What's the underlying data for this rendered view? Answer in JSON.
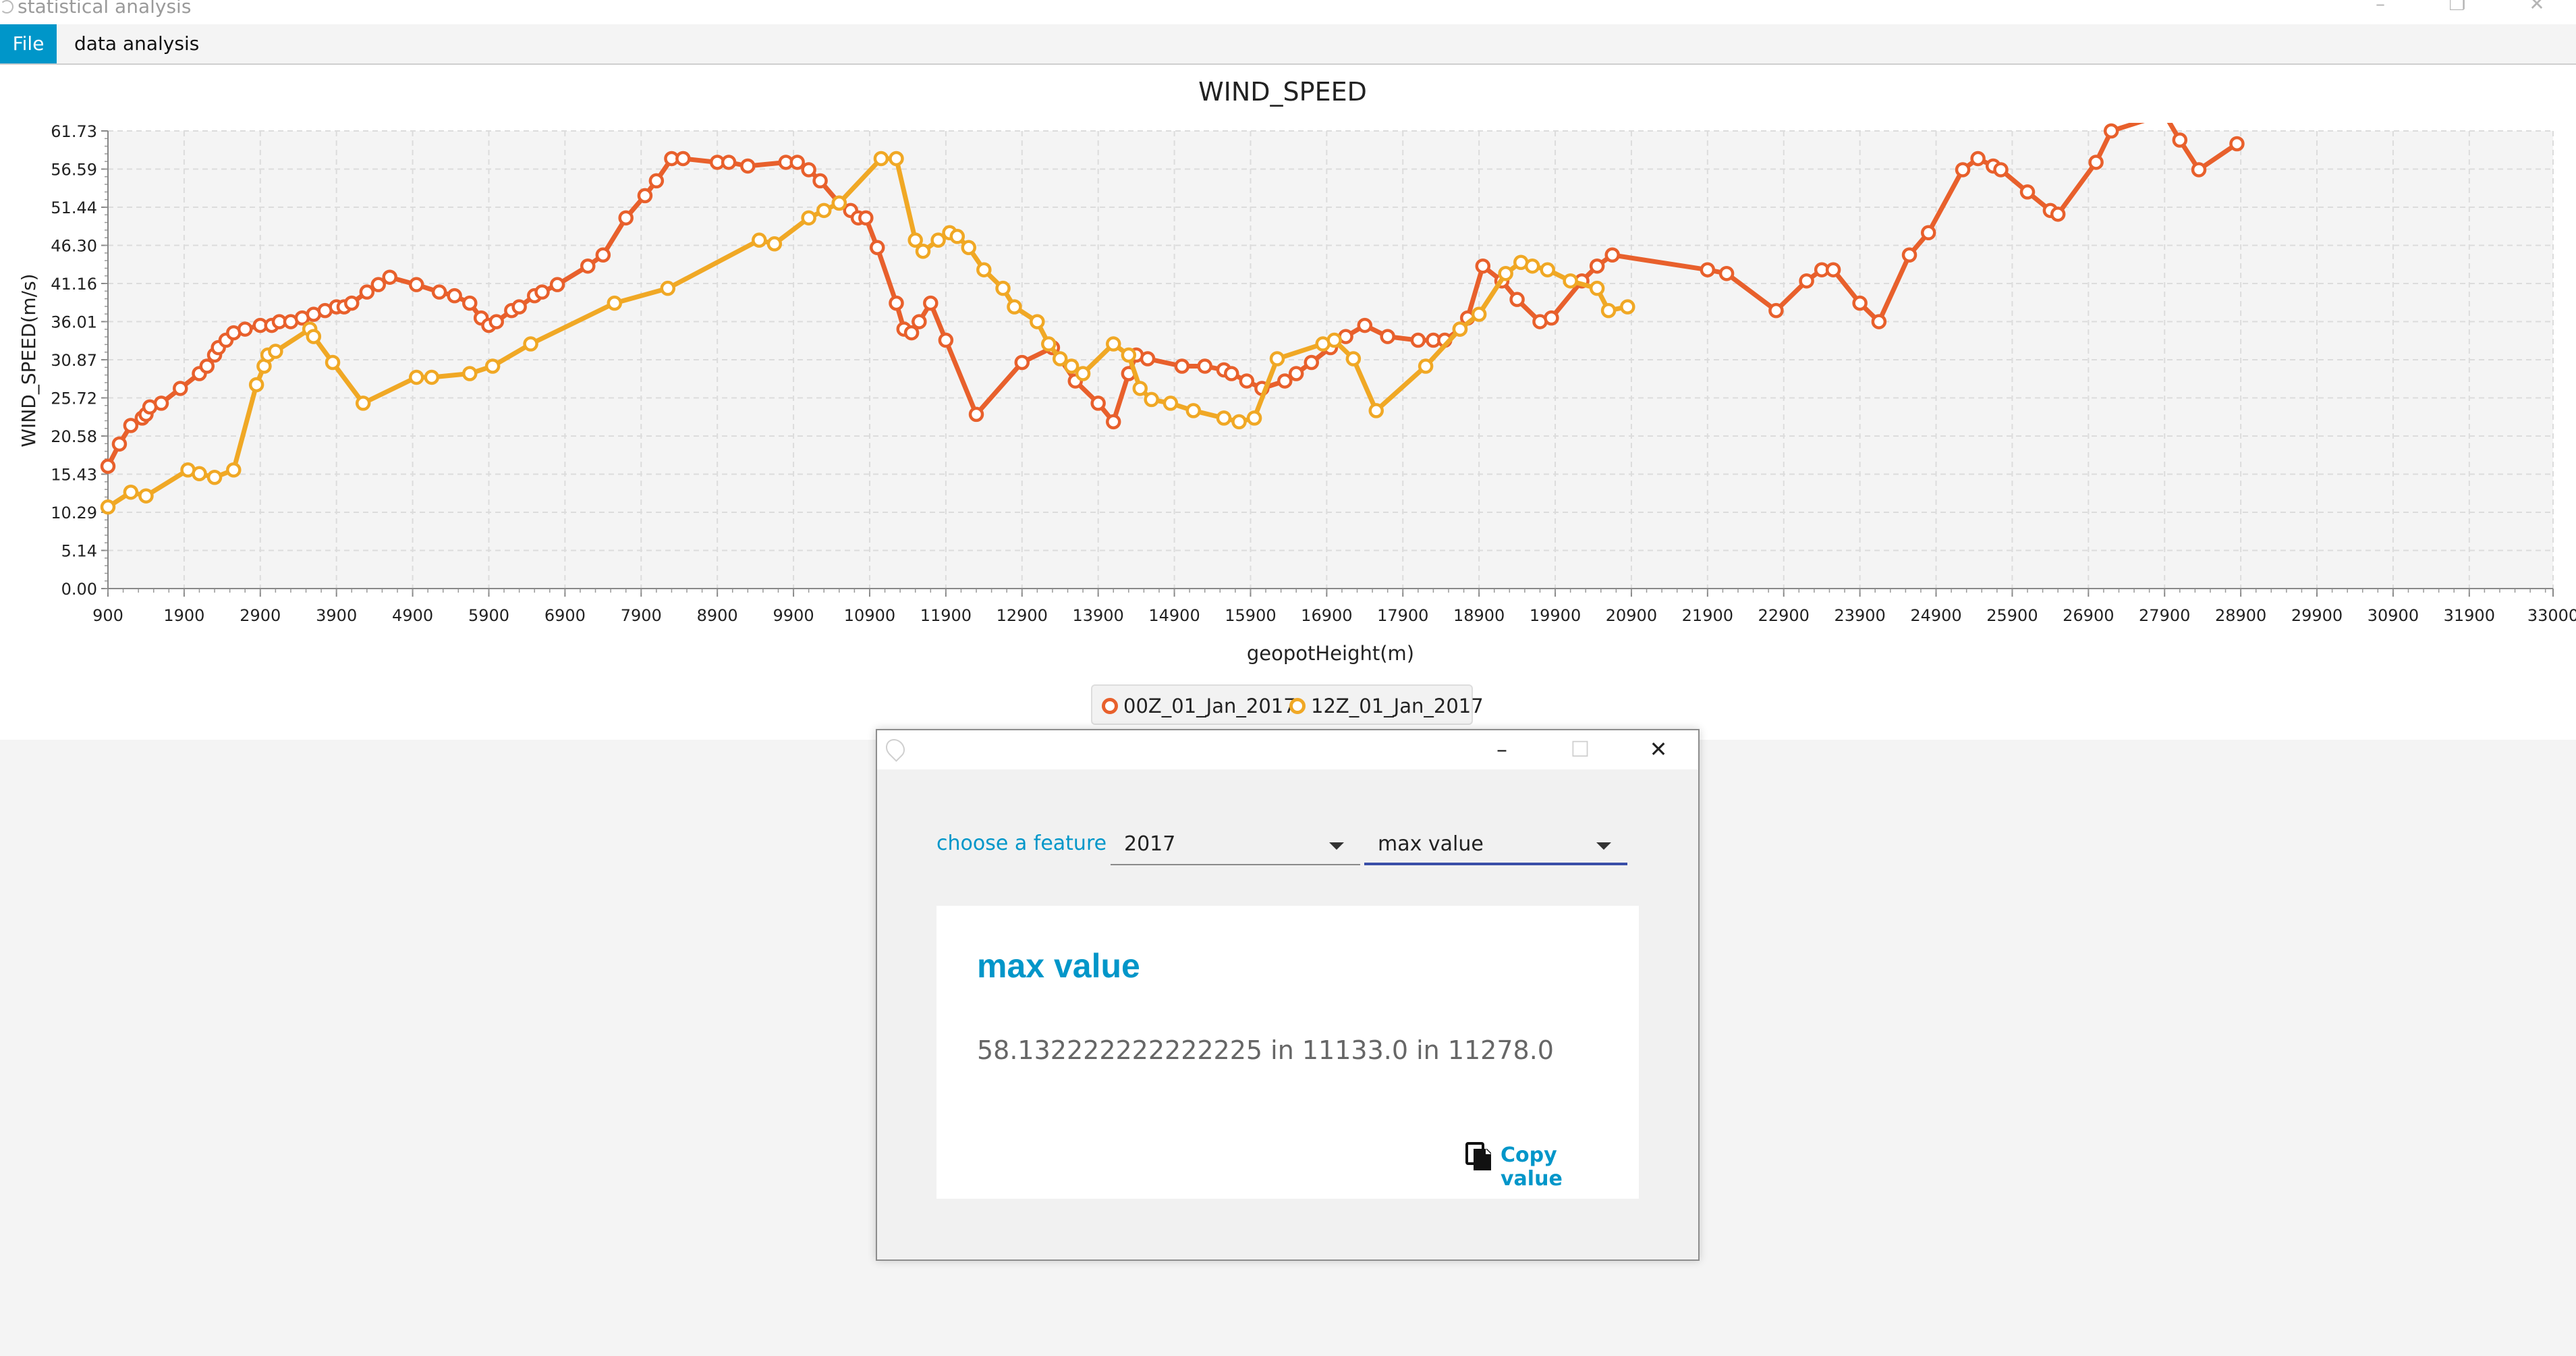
{
  "window": {
    "title": "statistical analysis",
    "controls": [
      "–",
      "❐",
      "✕"
    ]
  },
  "menu": {
    "file": "File",
    "data_analysis": "data analysis"
  },
  "chart_data": {
    "type": "line",
    "title": "WIND_SPEED",
    "xlabel": "geopotHeight(m)",
    "ylabel": "WIND_SPEED(m/s)",
    "xlim": [
      900,
      33000
    ],
    "ylim": [
      0,
      61.73
    ],
    "x_ticks": [
      "900",
      "1900",
      "2900",
      "3900",
      "4900",
      "5900",
      "6900",
      "7900",
      "8900",
      "9900",
      "10900",
      "11900",
      "12900",
      "13900",
      "14900",
      "15900",
      "16900",
      "17900",
      "18900",
      "19900",
      "20900",
      "21900",
      "22900",
      "23900",
      "24900",
      "25900",
      "26900",
      "27900",
      "28900",
      "29900",
      "30900",
      "31900",
      "33000"
    ],
    "y_ticks": [
      "0.00",
      "5.14",
      "10.29",
      "15.43",
      "20.58",
      "25.72",
      "30.87",
      "36.01",
      "41.16",
      "46.30",
      "51.44",
      "56.59",
      "61.73"
    ],
    "grid": true,
    "legend_position": "bottom",
    "series": [
      {
        "name": "00Z_01_Jan_2017",
        "color": "#e8602c",
        "points": [
          [
            900,
            16.5
          ],
          [
            1050,
            19.5
          ],
          [
            1200,
            22
          ],
          [
            1350,
            23
          ],
          [
            1400,
            23.5
          ],
          [
            1450,
            24.5
          ],
          [
            1600,
            25
          ],
          [
            1850,
            27
          ],
          [
            2100,
            29
          ],
          [
            2200,
            30
          ],
          [
            2300,
            31.5
          ],
          [
            2350,
            32.5
          ],
          [
            2450,
            33.5
          ],
          [
            2550,
            34.5
          ],
          [
            2700,
            35
          ],
          [
            2900,
            35.5
          ],
          [
            3050,
            35.5
          ],
          [
            3150,
            36
          ],
          [
            3300,
            36
          ],
          [
            3450,
            36.5
          ],
          [
            3600,
            37
          ],
          [
            3750,
            37.5
          ],
          [
            3900,
            38
          ],
          [
            4000,
            38
          ],
          [
            4100,
            38.5
          ],
          [
            4300,
            40
          ],
          [
            4450,
            41
          ],
          [
            4600,
            42
          ],
          [
            4950,
            41
          ],
          [
            5250,
            40
          ],
          [
            5450,
            39.5
          ],
          [
            5650,
            38.5
          ],
          [
            5800,
            36.5
          ],
          [
            5900,
            35.5
          ],
          [
            6000,
            36
          ],
          [
            6200,
            37.5
          ],
          [
            6300,
            38
          ],
          [
            6500,
            39.5
          ],
          [
            6600,
            40
          ],
          [
            6800,
            41
          ],
          [
            7200,
            43.5
          ],
          [
            7400,
            45
          ],
          [
            7700,
            50
          ],
          [
            7950,
            53
          ],
          [
            8100,
            55
          ],
          [
            8300,
            58
          ],
          [
            8450,
            58
          ],
          [
            8900,
            57.5
          ],
          [
            9050,
            57.5
          ],
          [
            9300,
            57
          ],
          [
            9800,
            57.5
          ],
          [
            9950,
            57.5
          ],
          [
            10100,
            56.5
          ],
          [
            10250,
            55
          ],
          [
            10500,
            52
          ],
          [
            10650,
            51
          ],
          [
            10750,
            50
          ],
          [
            10850,
            50
          ],
          [
            11000,
            46
          ],
          [
            11250,
            38.5
          ],
          [
            11350,
            35
          ],
          [
            11450,
            34.5
          ],
          [
            11550,
            36
          ],
          [
            11700,
            38.5
          ],
          [
            11900,
            33.5
          ],
          [
            12300,
            23.5
          ],
          [
            12900,
            30.5
          ],
          [
            13300,
            32.5
          ],
          [
            13600,
            28
          ],
          [
            13900,
            25
          ],
          [
            14100,
            22.5
          ],
          [
            14300,
            29
          ],
          [
            14400,
            31.5
          ],
          [
            14550,
            31
          ],
          [
            15000,
            30
          ],
          [
            15300,
            30
          ],
          [
            15550,
            29.5
          ],
          [
            15650,
            29
          ],
          [
            15850,
            28
          ],
          [
            16050,
            27
          ],
          [
            16350,
            28
          ],
          [
            16500,
            29
          ],
          [
            16700,
            30.5
          ],
          [
            16950,
            32.5
          ],
          [
            17150,
            34
          ],
          [
            17400,
            35.5
          ],
          [
            17700,
            34
          ],
          [
            18100,
            33.5
          ],
          [
            18300,
            33.5
          ],
          [
            18450,
            33.5
          ],
          [
            18650,
            35
          ],
          [
            18750,
            36.5
          ],
          [
            18950,
            43.5
          ],
          [
            19200,
            41.5
          ],
          [
            19400,
            39
          ],
          [
            19700,
            36
          ],
          [
            19850,
            36.5
          ],
          [
            20250,
            41.5
          ],
          [
            20450,
            43.5
          ],
          [
            20650,
            45
          ],
          [
            21900,
            43
          ],
          [
            22150,
            42.5
          ],
          [
            22800,
            37.5
          ],
          [
            23200,
            41.5
          ],
          [
            23400,
            43
          ],
          [
            23550,
            43
          ],
          [
            23900,
            38.5
          ],
          [
            24150,
            36
          ],
          [
            24550,
            45
          ],
          [
            24800,
            48
          ],
          [
            25250,
            56.5
          ],
          [
            25450,
            58
          ],
          [
            25650,
            57
          ],
          [
            25750,
            56.5
          ],
          [
            26100,
            53.5
          ],
          [
            26400,
            51
          ],
          [
            26500,
            50.5
          ],
          [
            27000,
            57.5
          ],
          [
            27200,
            61.73
          ],
          [
            27900,
            64
          ],
          [
            28100,
            60.5
          ],
          [
            28350,
            56.5
          ],
          [
            28850,
            60
          ]
        ]
      },
      {
        "name": "12Z_01_Jan_2017",
        "color": "#f0a825",
        "points": [
          [
            900,
            11
          ],
          [
            1200,
            13
          ],
          [
            1400,
            12.5
          ],
          [
            1950,
            16
          ],
          [
            2100,
            15.5
          ],
          [
            2300,
            15
          ],
          [
            2550,
            16
          ],
          [
            2850,
            27.5
          ],
          [
            2950,
            30
          ],
          [
            3000,
            31.5
          ],
          [
            3100,
            32
          ],
          [
            3550,
            35
          ],
          [
            3600,
            34
          ],
          [
            3850,
            30.5
          ],
          [
            4250,
            25
          ],
          [
            4950,
            28.5
          ],
          [
            5150,
            28.5
          ],
          [
            5650,
            29
          ],
          [
            5950,
            30
          ],
          [
            6450,
            33
          ],
          [
            7550,
            38.5
          ],
          [
            8250,
            40.5
          ],
          [
            9450,
            47
          ],
          [
            9650,
            46.5
          ],
          [
            10100,
            50
          ],
          [
            10300,
            51
          ],
          [
            10500,
            52
          ],
          [
            11050,
            58
          ],
          [
            11250,
            58
          ],
          [
            11500,
            47
          ],
          [
            11600,
            45.5
          ],
          [
            11800,
            47
          ],
          [
            11950,
            48
          ],
          [
            12050,
            47.5
          ],
          [
            12200,
            46
          ],
          [
            12400,
            43
          ],
          [
            12650,
            40.5
          ],
          [
            12800,
            38
          ],
          [
            13100,
            36
          ],
          [
            13250,
            33
          ],
          [
            13400,
            31
          ],
          [
            13550,
            30
          ],
          [
            13700,
            29
          ],
          [
            14100,
            33
          ],
          [
            14300,
            31.5
          ],
          [
            14450,
            27
          ],
          [
            14600,
            25.5
          ],
          [
            14850,
            25
          ],
          [
            15150,
            24
          ],
          [
            15550,
            23
          ],
          [
            15750,
            22.5
          ],
          [
            15950,
            23
          ],
          [
            16250,
            31
          ],
          [
            16850,
            33
          ],
          [
            17000,
            33.5
          ],
          [
            17250,
            31
          ],
          [
            17550,
            24
          ],
          [
            18200,
            30
          ],
          [
            18650,
            35
          ],
          [
            18900,
            37
          ],
          [
            19250,
            42.5
          ],
          [
            19450,
            44
          ],
          [
            19600,
            43.5
          ],
          [
            19800,
            43
          ],
          [
            20100,
            41.5
          ],
          [
            20450,
            40.5
          ],
          [
            20600,
            37.5
          ],
          [
            20850,
            38
          ]
        ]
      }
    ]
  },
  "legend": {
    "series1": "00Z_01_Jan_2017",
    "series2": "12Z_01_Jan_2017"
  },
  "dialog": {
    "controls": [
      "–",
      "☐",
      "✕"
    ],
    "feature_label": "choose a feature",
    "year_select": "2017",
    "stat_select": "max value",
    "result_title": "max value",
    "result_value": "58.132222222222225 in 11133.0 in 11278.0",
    "copy_label": "Copy value"
  },
  "colors": {
    "accent": "#0096c9",
    "series1": "#e8602c",
    "series2": "#f0a825",
    "focus_underline": "#3a4fa8"
  }
}
